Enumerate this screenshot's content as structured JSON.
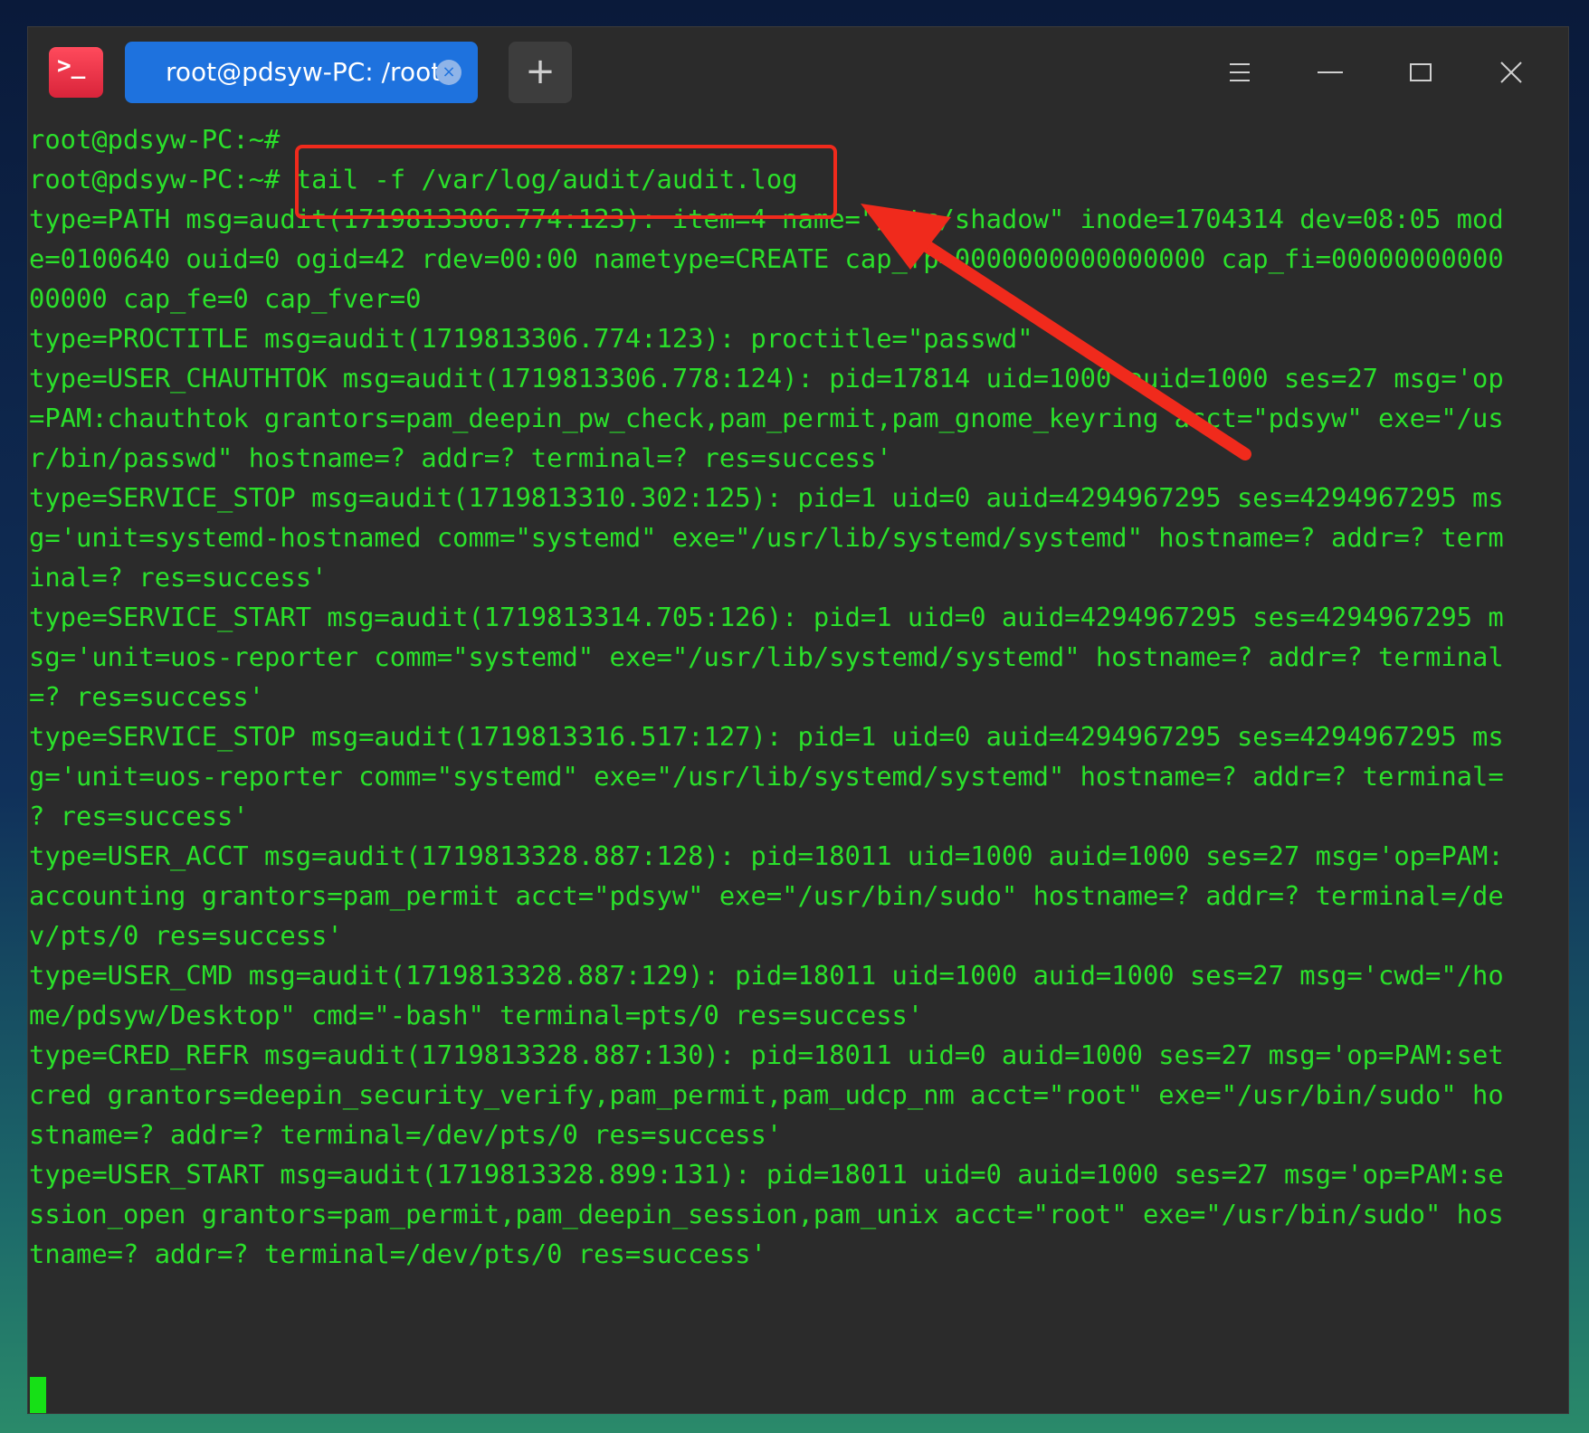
{
  "window": {
    "tab_title": "root@pdsyw-PC: /root",
    "tab_close_glyph": "×",
    "new_tab_glyph": "+",
    "app_icon_glyph": ">_",
    "icons": {
      "app": "terminal-icon",
      "menu": "hamburger-menu-icon",
      "minimize": "minimize-icon",
      "maximize": "maximize-icon",
      "close": "close-icon"
    }
  },
  "terminal": {
    "lines": [
      "root@pdsyw-PC:~#",
      "root@pdsyw-PC:~# tail -f /var/log/audit/audit.log",
      "type=PATH msg=audit(1719813306.774:123): item=4 name=\"/etc/shadow\" inode=1704314 dev=08:05 mod",
      "e=0100640 ouid=0 ogid=42 rdev=00:00 nametype=CREATE cap_fp=0000000000000000 cap_fi=00000000000",
      "00000 cap_fe=0 cap_fver=0",
      "type=PROCTITLE msg=audit(1719813306.774:123): proctitle=\"passwd\"",
      "type=USER_CHAUTHTOK msg=audit(1719813306.778:124): pid=17814 uid=1000 auid=1000 ses=27 msg='op",
      "=PAM:chauthtok grantors=pam_deepin_pw_check,pam_permit,pam_gnome_keyring acct=\"pdsyw\" exe=\"/us",
      "r/bin/passwd\" hostname=? addr=? terminal=? res=success'",
      "type=SERVICE_STOP msg=audit(1719813310.302:125): pid=1 uid=0 auid=4294967295 ses=4294967295 ms",
      "g='unit=systemd-hostnamed comm=\"systemd\" exe=\"/usr/lib/systemd/systemd\" hostname=? addr=? term",
      "inal=? res=success'",
      "type=SERVICE_START msg=audit(1719813314.705:126): pid=1 uid=0 auid=4294967295 ses=4294967295 m",
      "sg='unit=uos-reporter comm=\"systemd\" exe=\"/usr/lib/systemd/systemd\" hostname=? addr=? terminal",
      "=? res=success'",
      "type=SERVICE_STOP msg=audit(1719813316.517:127): pid=1 uid=0 auid=4294967295 ses=4294967295 ms",
      "g='unit=uos-reporter comm=\"systemd\" exe=\"/usr/lib/systemd/systemd\" hostname=? addr=? terminal=",
      "? res=success'",
      "type=USER_ACCT msg=audit(1719813328.887:128): pid=18011 uid=1000 auid=1000 ses=27 msg='op=PAM:",
      "accounting grantors=pam_permit acct=\"pdsyw\" exe=\"/usr/bin/sudo\" hostname=? addr=? terminal=/de",
      "v/pts/0 res=success'",
      "type=USER_CMD msg=audit(1719813328.887:129): pid=18011 uid=1000 auid=1000 ses=27 msg='cwd=\"/ho",
      "me/pdsyw/Desktop\" cmd=\"-bash\" terminal=pts/0 res=success'",
      "type=CRED_REFR msg=audit(1719813328.887:130): pid=18011 uid=0 auid=1000 ses=27 msg='op=PAM:set",
      "cred grantors=deepin_security_verify,pam_permit,pam_udcp_nm acct=\"root\" exe=\"/usr/bin/sudo\" ho",
      "stname=? addr=? terminal=/dev/pts/0 res=success'",
      "type=USER_START msg=audit(1719813328.899:131): pid=18011 uid=0 auid=1000 ses=27 msg='op=PAM:se",
      "ssion_open grantors=pam_permit,pam_deepin_session,pam_unix acct=\"root\" exe=\"/usr/bin/sudo\" hos",
      "tname=? addr=? terminal=/dev/pts/0 res=success'"
    ]
  },
  "colors": {
    "terminal_text": "#2be02b",
    "background": "#2b2b2b",
    "tab_active": "#1e72de",
    "annotation": "#f02a1c"
  }
}
